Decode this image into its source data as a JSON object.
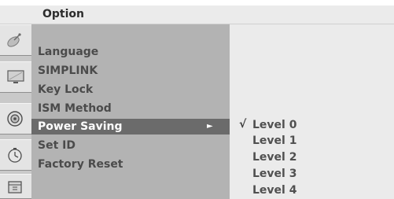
{
  "header": {
    "title": "Option"
  },
  "icons": [
    "satellite-icon",
    "tv-screen-icon",
    "speaker-icon",
    "clock-icon",
    "calendar-icon"
  ],
  "menu": {
    "items": [
      {
        "label": "Language"
      },
      {
        "label": "SIMPLINK"
      },
      {
        "label": "Key Lock"
      },
      {
        "label": "ISM Method"
      },
      {
        "label": "Power Saving",
        "arrow": "►"
      },
      {
        "label": "Set ID"
      },
      {
        "label": "Factory Reset"
      }
    ]
  },
  "submenu": {
    "check": "√",
    "options": [
      "Level 0",
      "Level 1",
      "Level 2",
      "Level 3",
      "Level 4"
    ]
  }
}
